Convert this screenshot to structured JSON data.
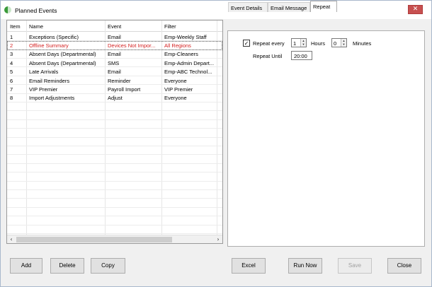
{
  "window": {
    "title": "Planned Events",
    "close_glyph": "✕"
  },
  "grid": {
    "columns": [
      "Item",
      "Name",
      "Event",
      "Filter"
    ],
    "rows": [
      {
        "item": "1",
        "name": "Exceptions (Specific)",
        "event": "Email",
        "filter": "Emp-Weekly Staff",
        "color": "#000000"
      },
      {
        "item": "2",
        "name": "Offline Summary",
        "event": "Devices Not Impor...",
        "filter": "All Regions",
        "color": "#d42020"
      },
      {
        "item": "3",
        "name": "Absent Days (Departmental)",
        "event": "Email",
        "filter": "Emp-Cleaners",
        "color": "#000000"
      },
      {
        "item": "4",
        "name": "Absent Days (Departmental)",
        "event": "SMS",
        "filter": "Emp-Admin Depart...",
        "color": "#000000"
      },
      {
        "item": "5",
        "name": "Late Arrivals",
        "event": "Email",
        "filter": "Emp-ABC Technol...",
        "color": "#000000"
      },
      {
        "item": "6",
        "name": "Email Reminders",
        "event": "Reminder",
        "filter": "Everyone",
        "color": "#000000"
      },
      {
        "item": "7",
        "name": "VIP Premier",
        "event": "Payroll Import",
        "filter": "VIP Premier",
        "color": "#000000"
      },
      {
        "item": "8",
        "name": "Import Adjustments",
        "event": "Adjust",
        "filter": "Everyone",
        "color": "#000000"
      }
    ],
    "scroll_left_glyph": "‹",
    "scroll_right_glyph": "›"
  },
  "tabs": [
    "Event Details",
    "Email Message",
    "Repeat"
  ],
  "active_tab": "Repeat",
  "repeat": {
    "checked": true,
    "check_glyph": "✓",
    "repeat_every_label": "Repeat every",
    "hours_value": "1",
    "hours_label": "Hours",
    "minutes_value": "0",
    "minutes_label": "Minutes",
    "repeat_until_label": "Repeat Until",
    "repeat_until_value": "20:00"
  },
  "buttons": {
    "add": "Add",
    "delete": "Delete",
    "copy": "Copy",
    "excel": "Excel",
    "run_now": "Run Now",
    "save": "Save",
    "close": "Close"
  },
  "icons": {
    "app": "leaf-icon",
    "close": "close-icon",
    "spin_up": "chevron-up-icon",
    "spin_down": "chevron-down-icon"
  },
  "colors": {
    "accent_red": "#d42020",
    "close_button": "#c75050",
    "app_icon": "#3a9a3a"
  }
}
